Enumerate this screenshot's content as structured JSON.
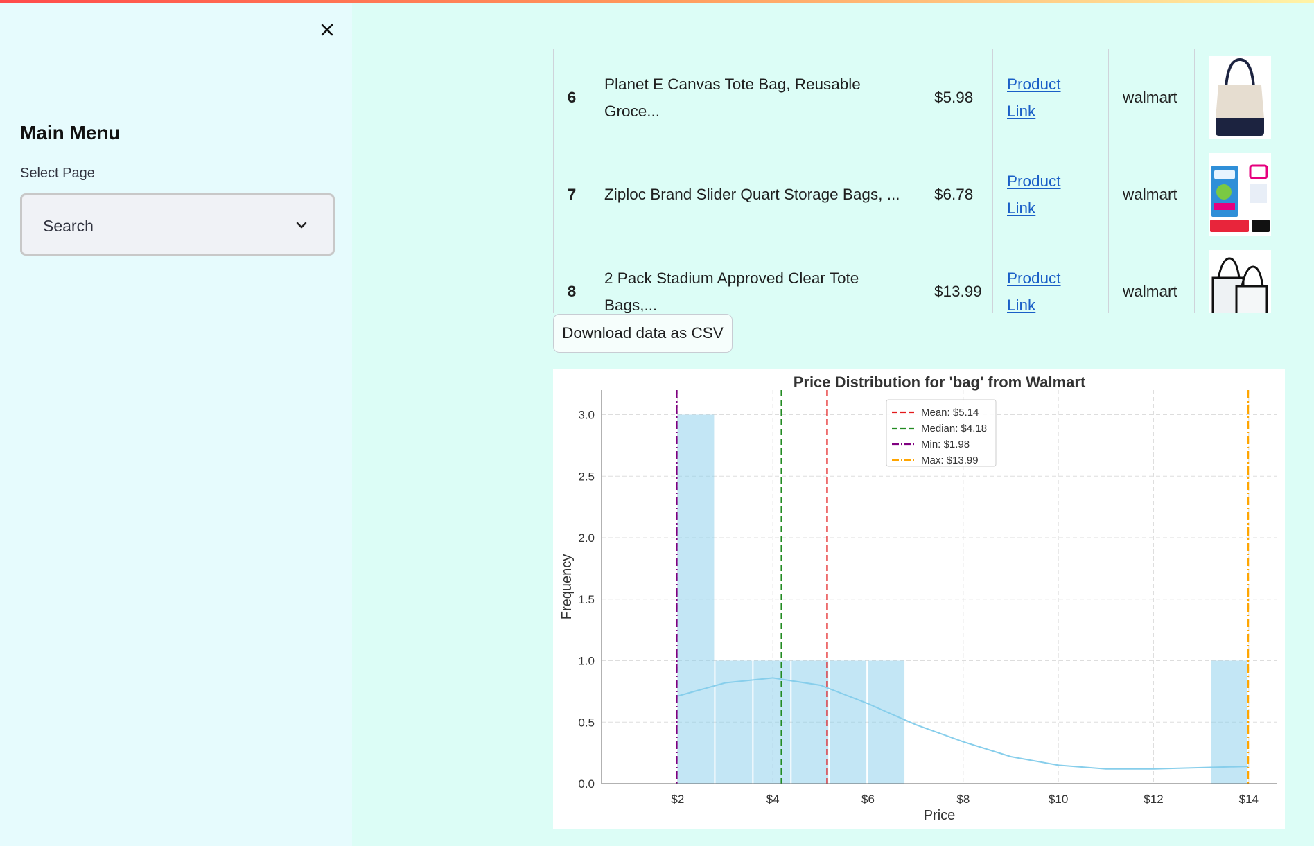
{
  "sidebar": {
    "close_icon": "close-icon",
    "title": "Main Menu",
    "select_label": "Select Page",
    "select_value": "Search"
  },
  "table": {
    "rows": [
      {
        "index": "6",
        "name": "Planet E Canvas Tote Bag, Reusable Groce...",
        "price": "$5.98",
        "link_line1": "Product",
        "link_line2": "Link",
        "store": "walmart",
        "image": "canvas-tote-bag-image"
      },
      {
        "index": "7",
        "name": "Ziploc Brand Slider Quart Storage Bags, ...",
        "price": "$6.78",
        "link_line1": "Product",
        "link_line2": "Link",
        "store": "walmart",
        "image": "ziploc-bags-box-image"
      },
      {
        "index": "8",
        "name": "2 Pack Stadium Approved Clear Tote Bags,...",
        "price": "$13.99",
        "link_line1": "Product",
        "link_line2": "Link",
        "store": "walmart",
        "image": "clear-tote-bags-image"
      }
    ]
  },
  "download_label": "Download data as CSV",
  "colors": {
    "bar": "#87ceeb",
    "mean": "#e31a1c",
    "median": "#228b22",
    "min": "#800080",
    "max": "#ffa500",
    "link": "#1a5fc7"
  },
  "chart_data": {
    "type": "bar",
    "title": "Price Distribution for 'bag' from Walmart",
    "xlabel": "Price",
    "ylabel": "Frequency",
    "xlim": [
      0.4,
      14.6
    ],
    "ylim": [
      0,
      3.2
    ],
    "xticks": [
      2,
      4,
      6,
      8,
      10,
      12,
      14
    ],
    "xtick_labels": [
      "$2",
      "$4",
      "$6",
      "$8",
      "$10",
      "$12",
      "$14"
    ],
    "yticks": [
      0.0,
      0.5,
      1.0,
      1.5,
      2.0,
      2.5,
      3.0
    ],
    "ytick_labels": [
      "0.0",
      "0.5",
      "1.0",
      "1.5",
      "2.0",
      "2.5",
      "3.0"
    ],
    "bins": [
      {
        "x0": 1.98,
        "x1": 2.78,
        "count": 3
      },
      {
        "x0": 2.78,
        "x1": 3.58,
        "count": 1
      },
      {
        "x0": 3.58,
        "x1": 4.38,
        "count": 1
      },
      {
        "x0": 4.38,
        "x1": 5.18,
        "count": 1
      },
      {
        "x0": 5.18,
        "x1": 5.98,
        "count": 1
      },
      {
        "x0": 5.98,
        "x1": 6.78,
        "count": 1
      },
      {
        "x0": 13.19,
        "x1": 13.99,
        "count": 1
      }
    ],
    "kde": {
      "x": [
        1.98,
        3.0,
        4.0,
        5.0,
        6.0,
        7.0,
        8.0,
        9.0,
        10.0,
        11.0,
        12.0,
        13.0,
        13.99
      ],
      "y": [
        0.71,
        0.82,
        0.86,
        0.8,
        0.65,
        0.48,
        0.34,
        0.22,
        0.15,
        0.12,
        0.12,
        0.13,
        0.14
      ]
    },
    "lines": [
      {
        "name": "Mean: $5.14",
        "value": 5.14,
        "style": "dashed",
        "color": "#e31a1c"
      },
      {
        "name": "Median: $4.18",
        "value": 4.18,
        "style": "dashed",
        "color": "#228b22"
      },
      {
        "name": "Min: $1.98",
        "value": 1.98,
        "style": "dashdot",
        "color": "#800080"
      },
      {
        "name": "Max: $13.99",
        "value": 13.99,
        "style": "dashdot",
        "color": "#ffa500"
      }
    ],
    "grid": true,
    "legend_position": "top-center"
  }
}
